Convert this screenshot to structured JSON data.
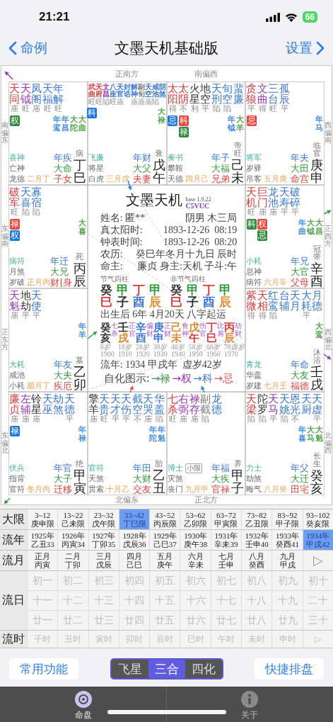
{
  "status_bar": {
    "time": "21:21",
    "battery": "66"
  },
  "nav": {
    "back": "命例",
    "title": "文墨天机基础版",
    "settings": "设置"
  },
  "directions": {
    "top": [
      "正南方",
      "南偏西"
    ],
    "bottom": [
      "北偏东",
      "正北方"
    ],
    "left": [
      "南偏东",
      "东偏南",
      "正东方",
      "东偏北"
    ],
    "right": [
      "西偏南",
      "正西方",
      "西偏北",
      "北偏西"
    ]
  },
  "palaces": [
    {
      "stars": [
        {
          "name": "天同",
          "color": "#d83b3b",
          "brightness": "庙",
          "hua": [
            {
              "text": "权",
              "color": "#2e8b3e"
            }
          ]
        },
        {
          "name": "天钺",
          "color": "#9c36b5",
          "brightness": "旺"
        },
        {
          "name": "凤阁",
          "color": "#3b78d4",
          "brightness": "庙"
        },
        {
          "name": "天福",
          "color": "#3b78d4",
          "brightness": "旺"
        },
        {
          "name": "年解",
          "color": "#3b78d4",
          "brightness": "旺"
        }
      ],
      "minor_stars": [
        {
          "name": "年鸾",
          "color": "#4a8fe0"
        },
        {
          "name": "年昌",
          "color": "#4a8fe0"
        },
        {
          "name": "大陀",
          "color": "#55a84f"
        },
        {
          "name": "大曲",
          "color": "#55a84f"
        }
      ],
      "gods": [
        "喜神",
        "亡神",
        "龙德"
      ],
      "month": "二月丁",
      "year_palace": "年疾",
      "decade_palace": "大命",
      "palace": "子女",
      "stage": "病",
      "ganzhi": "丁巳"
    },
    {
      "stars": [
        {
          "name": "武曲",
          "color": "#d83b3b",
          "brightness": "旺",
          "hua": [
            {
              "text": "科",
              "color": "#1c76e0"
            }
          ]
        },
        {
          "name": "天府",
          "color": "#d83b3b",
          "brightness": "旺"
        },
        {
          "name": "文昌",
          "color": "#9c36b5",
          "brightness": "陷"
        },
        {
          "name": "八座",
          "color": "#3b78d4",
          "brightness": "旺"
        },
        {
          "name": "天官",
          "color": "#3b78d4",
          "brightness": "庙"
        },
        {
          "name": "封诰",
          "color": "#3b78d4"
        },
        {
          "name": "解神",
          "color": "#3b78d4",
          "brightness": "庙"
        },
        {
          "name": "副旬",
          "color": "#777777",
          "brightness": "庙"
        },
        {
          "name": "天空",
          "color": "#3b78d4",
          "brightness": "庙"
        },
        {
          "name": "咸池",
          "color": "#3b78d4",
          "brightness": "陷"
        },
        {
          "name": "阴煞",
          "color": "#3b78d4"
        }
      ],
      "minor_stars": [
        {
          "name": "大禄",
          "color": "#55a84f"
        }
      ],
      "gods": [
        "飞廉",
        "将星",
        "白虎"
      ],
      "month": "三月戊",
      "year_palace": "年财",
      "decade_palace": "大父",
      "palace": "夫妻",
      "stage": "衰",
      "ganzhi": "戊午"
    },
    {
      "stars": [
        {
          "name": "太阳",
          "color": "#d83b3b",
          "brightness": "得",
          "hua": [
            {
              "text": "忌",
              "color": "#1c76e0"
            }
          ]
        },
        {
          "name": "太阴",
          "color": "#d83b3b",
          "brightness": "不",
          "hua": [
            {
              "text": "科",
              "color": "#e8453c"
            },
            {
              "text": "禄",
              "color": "#2e8b3e"
            }
          ]
        },
        {
          "name": "火星",
          "color": "#333333",
          "brightness": "利"
        },
        {
          "name": "地空",
          "color": "#333333",
          "brightness": "平"
        },
        {
          "name": "天刑",
          "color": "#3b78d4",
          "brightness": "陷"
        },
        {
          "name": "旬空",
          "color": "#3b78d4",
          "brightness": "陷"
        },
        {
          "name": "蜚廉",
          "color": "#3b78d4"
        }
      ],
      "minor_stars": [
        {
          "name": "年钺",
          "color": "#4a8fe0"
        },
        {
          "name": "大羊",
          "color": "#55a84f"
        }
      ],
      "gods": [
        "奏书",
        "攀鞍",
        "天德"
      ],
      "month": "四月己",
      "year_palace": "年子",
      "decade_palace": "大福",
      "palace": "兄弟",
      "stage": "帝旺",
      "ganzhi": "己未"
    },
    {
      "stars": [
        {
          "name": "贪狼",
          "color": "#d83b3b",
          "brightness": "平",
          "hua": [
            {
              "text": "忌",
              "color": "#e8453c"
            }
          ]
        },
        {
          "name": "文曲",
          "color": "#9c36b5",
          "brightness": "得"
        },
        {
          "name": "三台",
          "color": "#3b78d4",
          "brightness": "旺"
        },
        {
          "name": "孤辰",
          "color": "#3b78d4",
          "brightness": "平"
        }
      ],
      "minor_stars": [
        {
          "name": "年马",
          "color": "#4a8fe0"
        }
      ],
      "gods": [
        "将军",
        "岁驿",
        "吊客"
      ],
      "month": "五月庚",
      "year_palace": "年夫",
      "decade_palace": "大田",
      "palace": "命宫",
      "stage": "临官",
      "ganzhi": "庚申"
    },
    {
      "stars": [
        {
          "name": "破军",
          "color": "#d83b3b",
          "brightness": "旺",
          "hua": [
            {
              "text": "禄",
              "color": "#e8453c"
            },
            {
              "text": "权",
              "color": "#1c76e0"
            }
          ]
        },
        {
          "name": "天喜",
          "color": "#3b78d4",
          "brightness": "陷"
        },
        {
          "name": "寡宿",
          "color": "#3b78d4",
          "brightness": "陷"
        }
      ],
      "minor_stars": [
        {
          "name": "大喜",
          "color": "#55a84f"
        }
      ],
      "gods": [
        "病符",
        "月煞",
        "岁破"
      ],
      "month": "正月丙",
      "year_palace": "年迁",
      "decade_palace": "大兄",
      "palace": "财|身",
      "stage": "死",
      "ganzhi": "丙辰"
    },
    {
      "stars": [
        {
          "name": "天机",
          "color": "#d83b3b",
          "brightness": "旺",
          "hua": [
            {
              "text": "科",
              "color": "#2e8b3e"
            }
          ]
        },
        {
          "name": "巨门",
          "color": "#d83b3b",
          "brightness": "庙",
          "hua": [
            {
              "text": "权",
              "color": "#e8453c"
            },
            {
              "text": "忌",
              "color": "#2e8b3e"
            }
          ]
        },
        {
          "name": "龙池",
          "color": "#3b78d4",
          "brightness": "庙"
        },
        {
          "name": "天寿",
          "color": "#3b78d4",
          "brightness": "平"
        },
        {
          "name": "破碎",
          "color": "#3b78d4",
          "brightness": "平"
        }
      ],
      "minor_stars": [
        {
          "name": "年曲",
          "color": "#4a8fe0"
        },
        {
          "name": "大钺",
          "color": "#55a84f"
        },
        {
          "name": "大昌",
          "color": "#55a84f"
        }
      ],
      "gods": [
        "小耗",
        "息神",
        "病符"
      ],
      "month": "六月辛",
      "year_palace": "年兄",
      "decade_palace": "大官",
      "palace": "父母",
      "stage": "冠带",
      "ganzhi": "辛酉"
    },
    {
      "stars": [
        {
          "name": "天魁",
          "color": "#9c36b5",
          "brightness": "庙"
        },
        {
          "name": "地劫",
          "color": "#333333",
          "brightness": "平"
        },
        {
          "name": "天使",
          "color": "#3b78d4",
          "brightness": "平"
        }
      ],
      "minor_stars": [
        {
          "name": "年羊",
          "color": "#4a8fe0"
        }
      ],
      "gods": [
        "大耗",
        "咸池",
        "小耗"
      ],
      "month": "腊月丁",
      "year_palace": "年友",
      "decade_palace": "大夫",
      "palace": "疾厄",
      "stage": "墓",
      "ganzhi": "乙卯"
    },
    {
      "stars": [
        {
          "name": "紫微",
          "color": "#d83b3b",
          "brightness": "得"
        },
        {
          "name": "天相",
          "color": "#d83b3b",
          "brightness": "得"
        },
        {
          "name": "红鸾",
          "color": "#3b78d4",
          "brightness": "陷"
        },
        {
          "name": "台辅",
          "color": "#3b78d4"
        },
        {
          "name": "天月",
          "color": "#3b78d4"
        },
        {
          "name": "大耗",
          "color": "#3b78d4",
          "brightness": "平"
        },
        {
          "name": "月德",
          "color": "#3b78d4"
        }
      ],
      "minor_stars": [
        {
          "name": "大鸾",
          "color": "#55a84f"
        }
      ],
      "gods": [
        "青龙",
        "华盖",
        "岁建"
      ],
      "month": "七月壬",
      "year_palace": "年命",
      "decade_palace": "大友",
      "palace": "福德",
      "stage": "沐浴",
      "ganzhi": "壬戌"
    },
    {
      "stars": [
        {
          "name": "廉贞",
          "color": "#d83b3b",
          "brightness": "庙",
          "hua": [
            {
              "text": "禄",
              "color": "#1c76e0"
            }
          ]
        },
        {
          "name": "左辅",
          "color": "#9c36b5",
          "brightness": "庙"
        },
        {
          "name": "铃星",
          "color": "#333333",
          "brightness": "庙"
        },
        {
          "name": "天巫",
          "color": "#3b78d4"
        },
        {
          "name": "劫煞",
          "color": "#3b78d4"
        },
        {
          "name": "天德",
          "color": "#3b78d4",
          "brightness": "平"
        }
      ],
      "minor_stars": [
        {
          "name": "年禄",
          "color": "#4a8fe0"
        }
      ],
      "gods": [
        "伏兵",
        "指背",
        "官符"
      ],
      "month": "冬月丙",
      "year_palace": "年官",
      "decade_palace": "大子",
      "palace": "迁移",
      "stage": "绝",
      "ganzhi": "甲寅"
    },
    {
      "stars": [
        {
          "name": "擎羊",
          "color": "#333333",
          "brightness": "庙"
        },
        {
          "name": "天贵",
          "color": "#3b78d4",
          "brightness": "旺"
        },
        {
          "name": "天才",
          "color": "#3b78d4",
          "brightness": "平"
        },
        {
          "name": "天伤",
          "color": "#3b78d4",
          "brightness": "平"
        },
        {
          "name": "截空",
          "color": "#3b78d4",
          "brightness": "不"
        },
        {
          "name": "天哭",
          "color": "#3b78d4",
          "brightness": "庙"
        },
        {
          "name": "华盖",
          "color": "#3b78d4",
          "brightness": "陷"
        }
      ],
      "minor_stars": [
        {
          "name": "年陀",
          "color": "#4a8fe0"
        },
        {
          "name": "年魁",
          "color": "#4a8fe0"
        }
      ],
      "gods": [
        "官符",
        "天煞",
        "贯索"
      ],
      "month": "十月乙",
      "year_palace": "年田",
      "decade_palace": "大财",
      "palace": "交友",
      "stage": "胎",
      "ganzhi": "乙丑"
    },
    {
      "stars": [
        {
          "name": "七杀",
          "color": "#d83b3b",
          "brightness": "旺"
        },
        {
          "name": "右弼",
          "color": "#9c36b5",
          "brightness": "庙"
        },
        {
          "name": "禄存",
          "color": "#9c36b5",
          "brightness": "庙"
        },
        {
          "name": "副截",
          "color": "#777777",
          "brightness": "陷"
        },
        {
          "name": "龙德",
          "color": "#3b78d4"
        }
      ],
      "tag": "小限",
      "gods": [
        "博士",
        "灾煞",
        "丧门"
      ],
      "month": "九月甲",
      "year_palace": "年福",
      "decade_palace": "大疾",
      "palace": "官禄",
      "stage": "养",
      "ganzhi": "甲子"
    },
    {
      "stars": [
        {
          "name": "天梁",
          "color": "#d83b3b",
          "brightness": "陷"
        },
        {
          "name": "陀罗",
          "color": "#333333",
          "brightness": "陷"
        },
        {
          "name": "天马",
          "color": "#9c36b5",
          "brightness": "平"
        },
        {
          "name": "天姚",
          "color": "#3b78d4",
          "brightness": "陷"
        },
        {
          "name": "恩光",
          "color": "#3b78d4",
          "brightness": "不"
        },
        {
          "name": "天厨",
          "color": "#3b78d4"
        },
        {
          "name": "天虚",
          "color": "#3b78d4",
          "brightness": "平"
        }
      ],
      "minor_stars": [
        {
          "name": "年喜",
          "color": "#4a8fe0"
        },
        {
          "name": "大马",
          "color": "#55a84f"
        },
        {
          "name": "大魁",
          "color": "#55a84f"
        }
      ],
      "gods": [
        "力士",
        "劫煞",
        "晦气"
      ],
      "month": "八月癸",
      "year_palace": "年父",
      "decade_palace": "大迁",
      "palace": "田宅",
      "stage": "长生",
      "ganzhi": "癸亥"
    }
  ],
  "center": {
    "title": "文墨天机",
    "version": "base 1.9.22",
    "code": "C5VUC",
    "info": [
      {
        "label": "姓名: 匿**",
        "value": "阴男 木三局"
      },
      {
        "label": "真太阳时:",
        "value": "1893-12-26  08:19"
      },
      {
        "label": "钟表时间:",
        "value": "1893-12-26  08:20"
      },
      {
        "label": "农历:",
        "value": "癸巳年冬月十九日 辰时"
      },
      {
        "label": "命主:",
        "value": "廉贞 身主:天机 子斗:午"
      }
    ],
    "pillar_sets": [
      {
        "caption": "节气四柱",
        "pillars": [
          {
            "stem": {
              "text": "癸",
              "color": "#333333"
            },
            "branch": {
              "text": "巳",
              "color": "#d83b3b"
            }
          },
          {
            "stem": {
              "text": "甲",
              "color": "#2f9a3b"
            },
            "branch": {
              "text": "子",
              "color": "#333333"
            }
          },
          {
            "stem": {
              "text": "丁",
              "color": "#d83b3b"
            },
            "branch": {
              "text": "酉",
              "color": "#3b78d4"
            }
          },
          {
            "stem": {
              "text": "甲",
              "color": "#2f9a3b"
            },
            "branch": {
              "text": "辰",
              "color": "#e08a2e"
            }
          }
        ]
      },
      {
        "caption": "非节气四柱",
        "pillars": [
          {
            "stem": {
              "text": "癸",
              "color": "#333333"
            },
            "branch": {
              "text": "巳",
              "color": "#d83b3b"
            }
          },
          {
            "stem": {
              "text": "甲",
              "color": "#2f9a3b"
            },
            "branch": {
              "text": "子",
              "color": "#333333"
            }
          },
          {
            "stem": {
              "text": "丁",
              "color": "#d83b3b"
            },
            "branch": {
              "text": "酉",
              "color": "#3b78d4"
            }
          },
          {
            "stem": {
              "text": "甲",
              "color": "#2f9a3b"
            },
            "branch": {
              "text": "辰",
              "color": "#e08a2e"
            }
          }
        ]
      }
    ],
    "start_luck": "出生后 6年 4月20天 八字起运",
    "luck_pillars": [
      {
        "stem": {
          "text": "癸",
          "color": "#333333"
        },
        "branch": {
          "text": "亥",
          "color": "#333333"
        },
        "ten_god": "七杀",
        "age": "8岁",
        "year": "1900"
      },
      {
        "stem": {
          "text": "壬",
          "color": "#333333"
        },
        "branch": {
          "text": "戌",
          "color": "#e08a2e"
        },
        "ten_god": "正官",
        "age": "18岁",
        "year": "1910"
      },
      {
        "stem": {
          "text": "辛",
          "color": "#3b78d4"
        },
        "branch": {
          "text": "酉",
          "color": "#3b78d4"
        },
        "ten_god": "偏财",
        "age": "28岁",
        "year": "1920"
      },
      {
        "stem": {
          "text": "庚",
          "color": "#3b78d4"
        },
        "branch": {
          "text": "申",
          "color": "#3b78d4"
        },
        "ten_god": "正财",
        "age": "38岁",
        "year": "1930"
      },
      {
        "stem": {
          "text": "己",
          "color": "#e08a2e"
        },
        "branch": {
          "text": "未",
          "color": "#e08a2e"
        },
        "ten_god": "食神",
        "age": "48岁",
        "year": "1940"
      },
      {
        "stem": {
          "text": "戊",
          "color": "#e08a2e"
        },
        "branch": {
          "text": "午",
          "color": "#d83b3b"
        },
        "ten_god": "伤官",
        "age": "58岁",
        "year": "1950"
      },
      {
        "stem": {
          "text": "丁",
          "color": "#d83b3b"
        },
        "branch": {
          "text": "巳",
          "color": "#d83b3b"
        },
        "ten_god": "比肩",
        "age": "68岁",
        "year": "1960"
      },
      {
        "stem": {
          "text": "丙",
          "color": "#d83b3b"
        },
        "branch": {
          "text": "辰",
          "color": "#e08a2e"
        },
        "ten_god": "劫财",
        "age": "78虚岁",
        "year": "1970"
      }
    ],
    "flow_year": "流年: 1934 甲戌年  虚岁42岁",
    "legend_label": "自化图示:",
    "legend": [
      {
        "text": "→禄",
        "color": "#3a9a45"
      },
      {
        "text": "→权",
        "color": "#9c36b5"
      },
      {
        "text": "→科",
        "color": "#3b78d4"
      },
      {
        "text": "→忌",
        "color": "#e0504a"
      }
    ]
  },
  "luck_table": {
    "rows": [
      {
        "label": "大限",
        "kind": "two_line",
        "cells": [
          {
            "top": "3~12",
            "bottom": "庚申限",
            "selected": false
          },
          {
            "top": "13~22",
            "bottom": "己未限",
            "selected": false
          },
          {
            "top": "23~32",
            "bottom": "戊午限",
            "selected": false
          },
          {
            "top": "33~42",
            "bottom": "丁巳限",
            "selected": true
          },
          {
            "top": "43~52",
            "bottom": "丙辰限",
            "selected": false
          },
          {
            "top": "53~62",
            "bottom": "乙卯限",
            "selected": false
          },
          {
            "top": "63~72",
            "bottom": "甲寅限",
            "selected": false
          },
          {
            "top": "73~82",
            "bottom": "乙丑限",
            "selected": false
          },
          {
            "top": "83~92",
            "bottom": "甲子限",
            "selected": false
          },
          {
            "top": "93~102",
            "bottom": "癸亥限",
            "selected": false
          }
        ]
      },
      {
        "label": "流年",
        "kind": "two_line",
        "cells": [
          {
            "top": "1925年",
            "bottom": "乙丑33",
            "selected": false
          },
          {
            "top": "1926年",
            "bottom": "丙寅34",
            "selected": false
          },
          {
            "top": "1927年",
            "bottom": "丁卯35",
            "selected": false
          },
          {
            "top": "1928年",
            "bottom": "戊辰36",
            "selected": false
          },
          {
            "top": "1929年",
            "bottom": "己巳37",
            "selected": false
          },
          {
            "top": "1930年",
            "bottom": "庚午38",
            "selected": false
          },
          {
            "top": "1931年",
            "bottom": "辛未39",
            "selected": false
          },
          {
            "top": "1932年",
            "bottom": "壬申40",
            "selected": false
          },
          {
            "top": "1933年",
            "bottom": "癸酉41",
            "selected": false
          },
          {
            "top": "1934年",
            "bottom": "甲戌42",
            "selected": true
          }
        ]
      },
      {
        "label": "流月",
        "kind": "two_line",
        "cells": [
          {
            "top": "正月",
            "bottom": "丙寅",
            "selected": false
          },
          {
            "top": "二月",
            "bottom": "丁卯",
            "selected": false
          },
          {
            "top": "三月",
            "bottom": "戊辰",
            "selected": false
          },
          {
            "top": "四月",
            "bottom": "己巳",
            "selected": false
          },
          {
            "top": "五月",
            "bottom": "庚午",
            "selected": false
          },
          {
            "top": "六月",
            "bottom": "辛未",
            "selected": false
          },
          {
            "top": "七月",
            "bottom": "壬申",
            "selected": false
          },
          {
            "top": "八月",
            "bottom": "癸酉",
            "selected": false
          },
          {
            "top": "九月",
            "bottom": "甲戌",
            "selected": false
          },
          {
            "kind": "next",
            "text": "▷",
            "selected": false
          }
        ]
      },
      {
        "label": "流日",
        "kind": "grid",
        "disabled": true,
        "lines": [
          [
            "初一",
            "初二",
            "初三",
            "初四",
            "初五",
            "初六",
            "初七",
            "初八",
            "初九",
            "初十"
          ],
          [
            "十一",
            "十二",
            "十三",
            "十四",
            "十五",
            "十六",
            "十七",
            "十八",
            "十九",
            "二十"
          ],
          [
            "廿一",
            "廿二",
            "廿三",
            "廿四",
            "廿五",
            "廿六",
            "廿七",
            "廿八",
            "廿九",
            "三十"
          ]
        ]
      },
      {
        "label": "流时",
        "kind": "one_line",
        "disabled": true,
        "cells": [
          "子时",
          "丑时",
          "寅时",
          "卯时",
          "辰时",
          "巳时",
          "午时",
          "未时",
          "申时",
          "▷"
        ]
      }
    ]
  },
  "actions": {
    "left": "常用功能",
    "right": "快捷排盘",
    "segments": [
      {
        "label": "飞星",
        "selected": false
      },
      {
        "label": "三合",
        "selected": true
      },
      {
        "label": "四化",
        "selected": false
      }
    ]
  },
  "tabs": [
    {
      "label": "命盘",
      "kind": "chart",
      "selected": true
    },
    {
      "label": "关于",
      "kind": "info",
      "selected": false
    }
  ]
}
